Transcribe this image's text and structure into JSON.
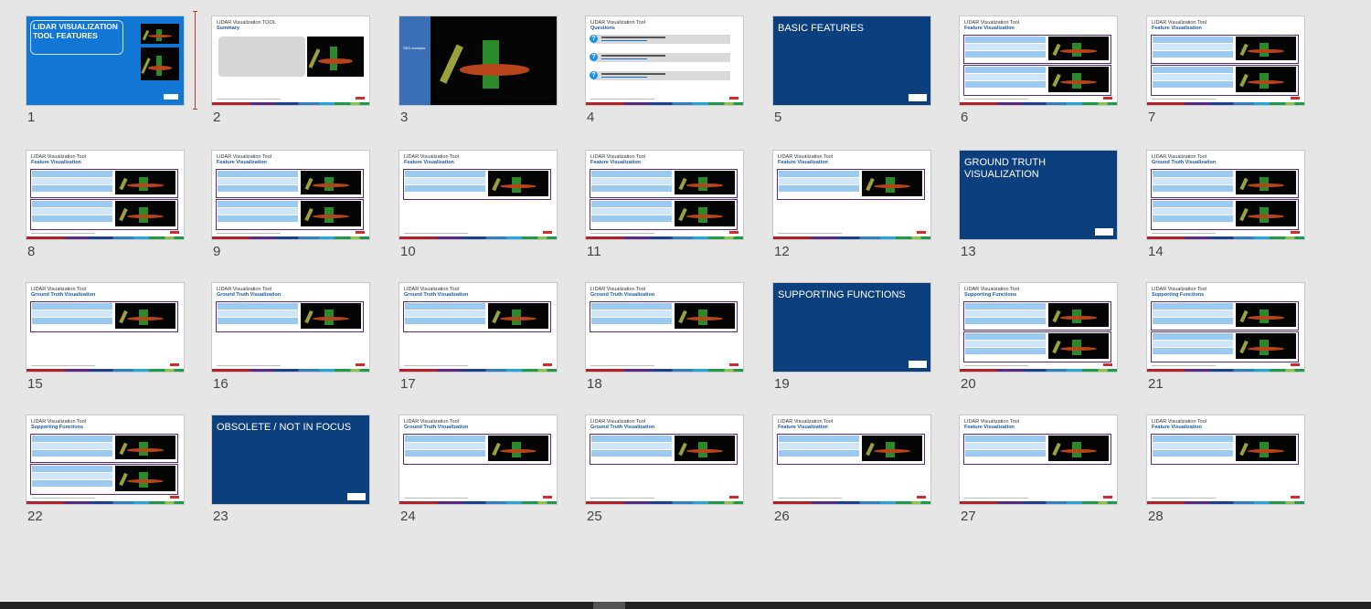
{
  "colors": {
    "title_blue": "#1176d4",
    "section_navy": "#0c3f7e",
    "accent_red": "#d42a2a",
    "table_blue": "#9cc9ef",
    "outline_purple": "#5a2a82"
  },
  "slides": [
    {
      "number": "1",
      "kind": "title",
      "title": "LIDAR VISUALIZATION TOOL FEATURES"
    },
    {
      "number": "2",
      "kind": "summary",
      "title": "LIDAR Visualization TOOL",
      "subtitle": "Summary"
    },
    {
      "number": "3",
      "kind": "example",
      "title": "SED example"
    },
    {
      "number": "4",
      "kind": "questions",
      "title": "LIDAR Visualization Tool",
      "subtitle": "Questions"
    },
    {
      "number": "5",
      "kind": "section",
      "title": "BASIC FEATURES"
    },
    {
      "number": "6",
      "kind": "two",
      "title": "LIDAR Visualization Tool",
      "subtitle": "Feature Visualization"
    },
    {
      "number": "7",
      "kind": "two",
      "title": "LIDAR Visualization Tool",
      "subtitle": "Feature Visualization"
    },
    {
      "number": "8",
      "kind": "two",
      "title": "LIDAR Visualization Tool",
      "subtitle": "Feature Visualization"
    },
    {
      "number": "9",
      "kind": "two",
      "title": "LIDAR Visualization Tool",
      "subtitle": "Feature Visualization"
    },
    {
      "number": "10",
      "kind": "one",
      "title": "LIDAR Visualization Tool",
      "subtitle": "Feature Visualization"
    },
    {
      "number": "11",
      "kind": "two",
      "title": "LIDAR Visualization Tool",
      "subtitle": "Feature Visualization"
    },
    {
      "number": "12",
      "kind": "one",
      "title": "LIDAR Visualization Tool",
      "subtitle": "Feature Visualization"
    },
    {
      "number": "13",
      "kind": "section",
      "title": "GROUND TRUTH VISUALIZATION"
    },
    {
      "number": "14",
      "kind": "two",
      "title": "LIDAR Visualization Tool",
      "subtitle": "Ground Truth Visualization"
    },
    {
      "number": "15",
      "kind": "one",
      "title": "LIDAR Visualization Tool",
      "subtitle": "Ground Truth Visualization"
    },
    {
      "number": "16",
      "kind": "one",
      "title": "LIDAR Visualization Tool",
      "subtitle": "Ground Truth Visualization"
    },
    {
      "number": "17",
      "kind": "one",
      "title": "LIDAR Visualization Tool",
      "subtitle": "Ground Truth Visualization"
    },
    {
      "number": "18",
      "kind": "one",
      "title": "LIDAR Visualization Tool",
      "subtitle": "Ground Truth Visualization"
    },
    {
      "number": "19",
      "kind": "section",
      "title": "SUPPORTING FUNCTIONS"
    },
    {
      "number": "20",
      "kind": "two",
      "title": "LIDAR Visualization Tool",
      "subtitle": "Supporting Functions"
    },
    {
      "number": "21",
      "kind": "two",
      "title": "LIDAR Visualization Tool",
      "subtitle": "Supporting Functions"
    },
    {
      "number": "22",
      "kind": "two",
      "title": "LIDAR Visualization Tool",
      "subtitle": "Supporting Functions"
    },
    {
      "number": "23",
      "kind": "section",
      "title": "OBSOLETE / NOT IN FOCUS"
    },
    {
      "number": "24",
      "kind": "one",
      "title": "LIDAR Visualization Tool",
      "subtitle": "Ground Truth Visualization"
    },
    {
      "number": "25",
      "kind": "one",
      "title": "LIDAR Visualization Tool",
      "subtitle": "Ground Truth Visualization"
    },
    {
      "number": "26",
      "kind": "one",
      "title": "LIDAR Visualization Tool",
      "subtitle": "Feature Visualization"
    },
    {
      "number": "27",
      "kind": "one",
      "title": "LIDAR Visualization Tool",
      "subtitle": "Feature Visualization"
    },
    {
      "number": "28",
      "kind": "one",
      "title": "LIDAR Visualization Tool",
      "subtitle": "Feature Visualization"
    }
  ]
}
